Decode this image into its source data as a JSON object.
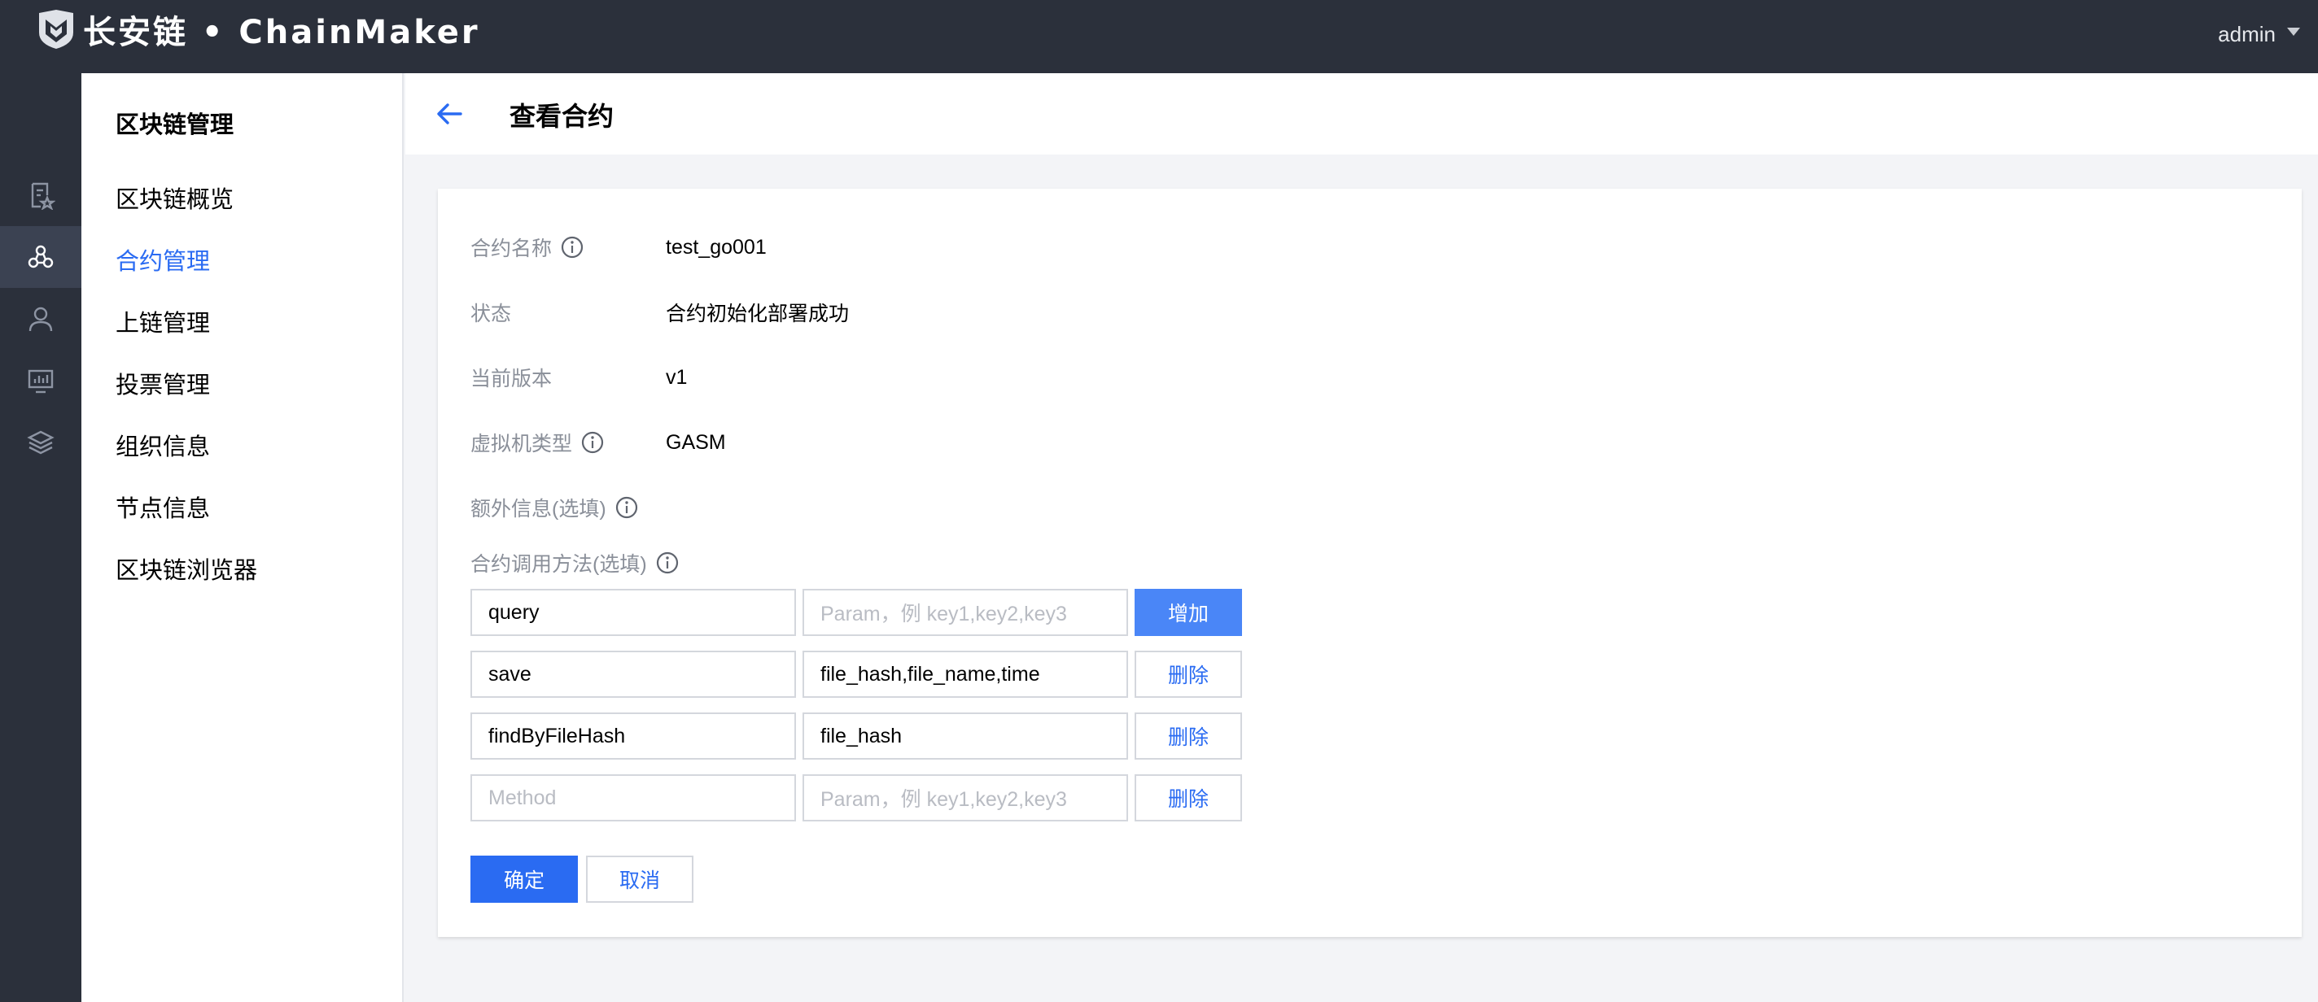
{
  "topbar": {
    "logo_text": "长安链 • ChainMaker",
    "user": "admin"
  },
  "rail": {
    "icons": [
      "contract-doc-icon",
      "blockchain-network-icon",
      "user-icon",
      "monitor-icon",
      "layers-icon"
    ],
    "active_index": 1
  },
  "subnav": {
    "title": "区块链管理",
    "items": [
      "区块链概览",
      "合约管理",
      "上链管理",
      "投票管理",
      "组织信息",
      "节点信息",
      "区块链浏览器"
    ],
    "active_index": 1
  },
  "header": {
    "title": "查看合约"
  },
  "form": {
    "name_label": "合约名称",
    "name_value": "test_go001",
    "status_label": "状态",
    "status_value": "合约初始化部署成功",
    "version_label": "当前版本",
    "version_value": "v1",
    "vm_label": "虚拟机类型",
    "vm_value": "GASM",
    "extra_label": "额外信息(选填)",
    "methods_label": "合约调用方法(选填)",
    "methods": [
      {
        "method": "query",
        "param": "",
        "action": "增加"
      },
      {
        "method": "save",
        "param": "file_hash,file_name,time",
        "action": "删除"
      },
      {
        "method": "findByFileHash",
        "param": "file_hash",
        "action": "删除"
      },
      {
        "method": "",
        "param": "",
        "action": "删除"
      }
    ],
    "method_placeholder": "Method",
    "param_placeholder": "Param，例 key1,key2,key3",
    "confirm_label": "确定",
    "cancel_label": "取消"
  },
  "colors": {
    "accent": "#2a6bf2",
    "topbar": "#2b303b",
    "add_button": "#4a86f7"
  }
}
